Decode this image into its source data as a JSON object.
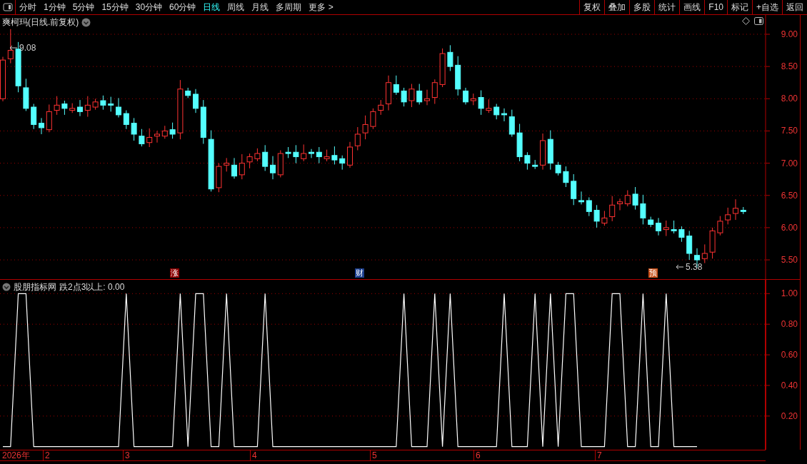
{
  "toolbar": {
    "periods": [
      {
        "label": "分时",
        "selected": false
      },
      {
        "label": "1分钟",
        "selected": false
      },
      {
        "label": "5分钟",
        "selected": false
      },
      {
        "label": "15分钟",
        "selected": false
      },
      {
        "label": "30分钟",
        "selected": false
      },
      {
        "label": "60分钟",
        "selected": false
      },
      {
        "label": "日线",
        "selected": true
      },
      {
        "label": "周线",
        "selected": false
      },
      {
        "label": "月线",
        "selected": false
      },
      {
        "label": "多周期",
        "selected": false
      },
      {
        "label": "更多 >",
        "selected": false
      }
    ],
    "actions": [
      "复权",
      "叠加",
      "多股",
      "统计",
      "画线",
      "F10",
      "标记",
      "+自选",
      "返回"
    ]
  },
  "price_panel": {
    "title": "爽柯玛(日线.前复权)",
    "high_label": "9.08",
    "low_label": "5.38",
    "axis": [
      "9.00",
      "8.50",
      "8.00",
      "7.50",
      "7.00",
      "6.50",
      "6.00",
      "5.50"
    ],
    "markers": [
      {
        "label": "涨",
        "color": "#8b0000"
      },
      {
        "label": "财",
        "color": "#1c3f8f"
      },
      {
        "label": "预",
        "color": "#c8501a"
      }
    ]
  },
  "indicator_panel": {
    "source": "股朋指标网",
    "reading": ": 0.00",
    "chart_data": {
      "type": "line",
      "grid": true,
      "yticks": [
        {
          "value": 0.2,
          "label": "0.20"
        },
        {
          "value": 0.4,
          "label": "0.40"
        },
        {
          "value": 0.6,
          "label": "0.60"
        },
        {
          "value": 0.8,
          "label": "0.80"
        },
        {
          "value": 1.0,
          "label": "1.00"
        }
      ],
      "ylim": [
        -0.02,
        1.09
      ],
      "series": [
        {
          "name": "跌2点3以上",
          "color": "#ffffff",
          "values": [
            0,
            0,
            1,
            1,
            0,
            0,
            0,
            0,
            0,
            0,
            0,
            0,
            0,
            0,
            0,
            0,
            1,
            0,
            0,
            0,
            0,
            0,
            0,
            1,
            0,
            1,
            1,
            0,
            0,
            1,
            0,
            0,
            0,
            0,
            1,
            0,
            0,
            0,
            0,
            0,
            0,
            0,
            0,
            0,
            0,
            0,
            0,
            0,
            0,
            0,
            0,
            0,
            1,
            0,
            0,
            0,
            1,
            0,
            1,
            0,
            0,
            0,
            0,
            0,
            0,
            1,
            0,
            0,
            0,
            1,
            0,
            1,
            0,
            1,
            1,
            0,
            0,
            0,
            0,
            1,
            1,
            0,
            0,
            1,
            0,
            0,
            1,
            0,
            0,
            0,
            0,
            null,
            null,
            null,
            null,
            null,
            null
          ]
        }
      ]
    }
  },
  "date_axis": [
    "2026年",
    "2",
    "3",
    "4",
    "5",
    "6",
    "7"
  ]
}
